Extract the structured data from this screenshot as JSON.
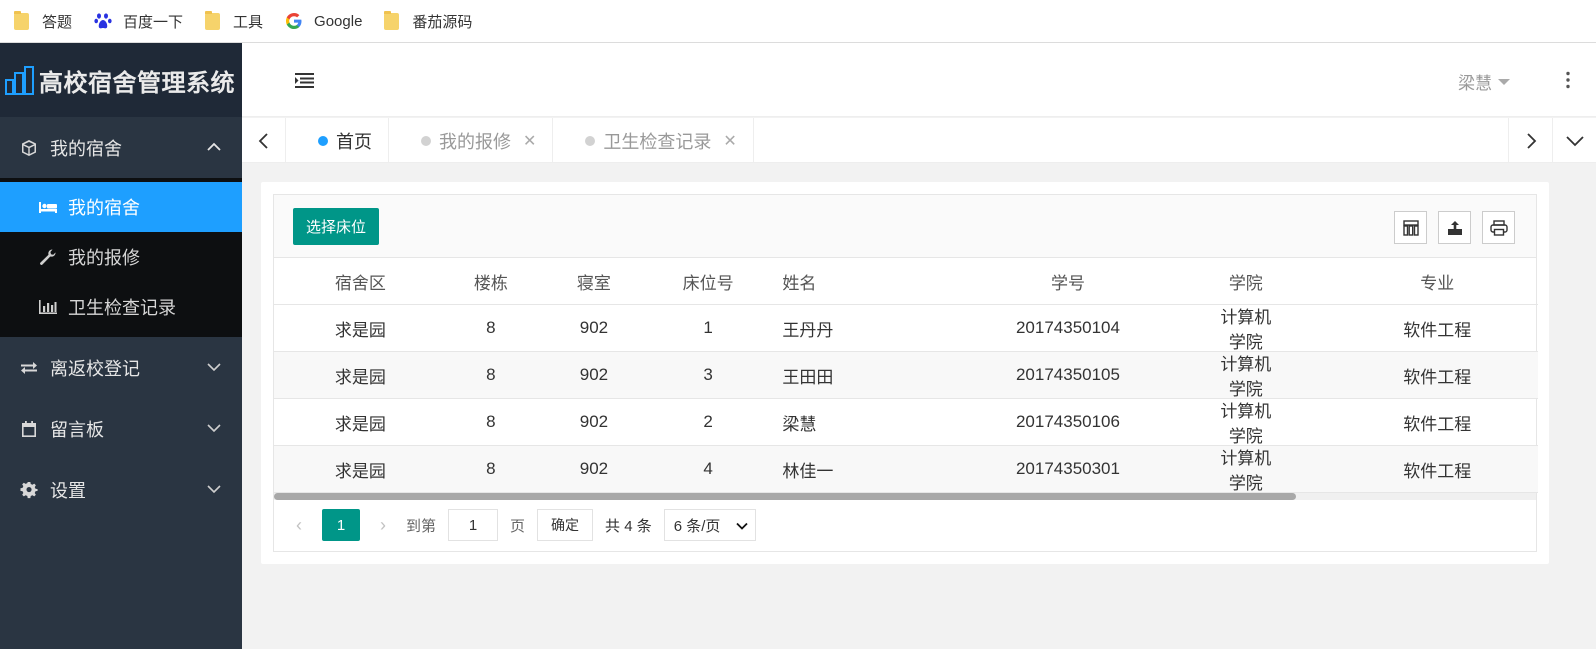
{
  "bookmarks": [
    {
      "label": "答题",
      "icon": "folder-icon"
    },
    {
      "label": "百度一下",
      "icon": "baidu-paw-icon"
    },
    {
      "label": "工具",
      "icon": "folder-icon"
    },
    {
      "label": "Google",
      "icon": "google-icon"
    },
    {
      "label": "番茄源码",
      "icon": "folder-icon"
    }
  ],
  "app": {
    "title": "高校宿舍管理系统"
  },
  "sidebar": {
    "groups": [
      {
        "label": "我的宿舍",
        "icon": "cube-icon",
        "expanded": true
      },
      {
        "label": "离返校登记",
        "icon": "exchange-icon",
        "expanded": false
      },
      {
        "label": "留言板",
        "icon": "calendar-icon",
        "expanded": false
      },
      {
        "label": "设置",
        "icon": "gear-icon",
        "expanded": false
      }
    ],
    "subitems": [
      {
        "label": "我的宿舍",
        "icon": "bed-icon",
        "active": true
      },
      {
        "label": "我的报修",
        "icon": "wrench-icon",
        "active": false
      },
      {
        "label": "卫生检查记录",
        "icon": "bar-chart-icon",
        "active": false
      }
    ]
  },
  "header": {
    "user": "梁慧"
  },
  "tabs": [
    {
      "label": "首页",
      "active": true,
      "closable": false
    },
    {
      "label": "我的报修",
      "active": false,
      "closable": true
    },
    {
      "label": "卫生检查记录",
      "active": false,
      "closable": true
    }
  ],
  "toolbar": {
    "select_bed_label": "选择床位"
  },
  "table": {
    "columns": [
      "宿舍区",
      "楼栋",
      "寝室",
      "床位号",
      "姓名",
      "学号",
      "学院",
      "专业"
    ],
    "rows": [
      [
        "求是园",
        "8",
        "902",
        "1",
        "王丹丹",
        "20174350104",
        "计算机学院",
        "软件工程"
      ],
      [
        "求是园",
        "8",
        "902",
        "3",
        "王田田",
        "20174350105",
        "计算机学院",
        "软件工程"
      ],
      [
        "求是园",
        "8",
        "902",
        "2",
        "梁慧",
        "20174350106",
        "计算机学院",
        "软件工程"
      ],
      [
        "求是园",
        "8",
        "902",
        "4",
        "林佳一",
        "20174350301",
        "计算机学院",
        "软件工程"
      ]
    ]
  },
  "pager": {
    "current": "1",
    "goto_prefix": "到第",
    "goto_value": "1",
    "goto_suffix": "页",
    "confirm": "确定",
    "total": "共 4 条",
    "page_size": "6 条/页"
  },
  "colors": {
    "accent": "#1e9fff",
    "primary": "#009688",
    "sidebar": "#2a3542"
  }
}
